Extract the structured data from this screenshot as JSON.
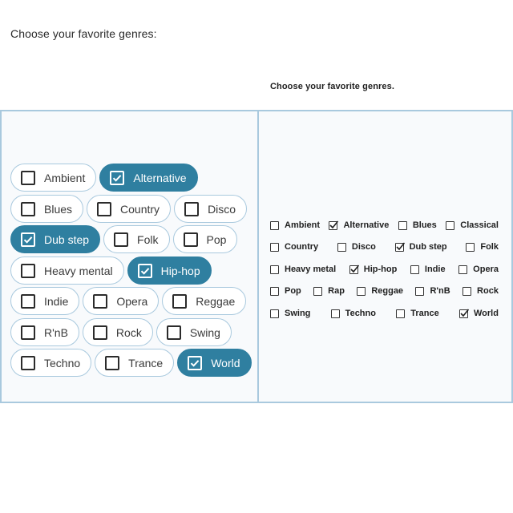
{
  "left_panel": {
    "title": "Choose your favorite genres:",
    "rows": [
      [
        {
          "label": "Ambient",
          "checked": false
        },
        {
          "label": "Alternative",
          "checked": true
        }
      ],
      [
        {
          "label": "Blues",
          "checked": false
        },
        {
          "label": "Country",
          "checked": false
        },
        {
          "label": "Disco",
          "checked": false
        }
      ],
      [
        {
          "label": "Dub step",
          "checked": true
        },
        {
          "label": "Folk",
          "checked": false
        },
        {
          "label": "Pop",
          "checked": false
        }
      ],
      [
        {
          "label": "Heavy mental",
          "checked": false
        },
        {
          "label": "Hip-hop",
          "checked": true
        }
      ],
      [
        {
          "label": "Indie",
          "checked": false
        },
        {
          "label": "Opera",
          "checked": false
        },
        {
          "label": "Reggae",
          "checked": false
        }
      ],
      [
        {
          "label": "R'nB",
          "checked": false
        },
        {
          "label": "Rock",
          "checked": false
        },
        {
          "label": "Swing",
          "checked": false
        }
      ],
      [
        {
          "label": "Techno",
          "checked": false
        },
        {
          "label": "Trance",
          "checked": false
        },
        {
          "label": "World",
          "checked": true
        }
      ]
    ]
  },
  "right_panel": {
    "title": "Choose your favorite genres.",
    "rows": [
      [
        {
          "label": "Ambient",
          "checked": false
        },
        {
          "label": "Alternative",
          "checked": true
        },
        {
          "label": "Blues",
          "checked": false
        },
        {
          "label": "Classical",
          "checked": false
        }
      ],
      [
        {
          "label": "Country",
          "checked": false
        },
        {
          "label": "Disco",
          "checked": false
        },
        {
          "label": "Dub step",
          "checked": true
        },
        {
          "label": "Folk",
          "checked": false
        }
      ],
      [
        {
          "label": "Heavy metal",
          "checked": false
        },
        {
          "label": "Hip-hop",
          "checked": true
        },
        {
          "label": "Indie",
          "checked": false
        },
        {
          "label": "Opera",
          "checked": false
        }
      ],
      [
        {
          "label": "Pop",
          "checked": false
        },
        {
          "label": "Rap",
          "checked": false
        },
        {
          "label": "Reggae",
          "checked": false
        },
        {
          "label": "R'nB",
          "checked": false
        },
        {
          "label": "Rock",
          "checked": false
        }
      ],
      [
        {
          "label": "Swing",
          "checked": false
        },
        {
          "label": "Techno",
          "checked": false
        },
        {
          "label": "Trance",
          "checked": false
        },
        {
          "label": "World",
          "checked": true
        }
      ]
    ]
  },
  "colors": {
    "accent": "#2f7fa0",
    "border": "#a9c9de",
    "background": "#f8fafc"
  },
  "icons": {
    "checked": "checkmark-icon",
    "unchecked": "checkbox-icon"
  }
}
